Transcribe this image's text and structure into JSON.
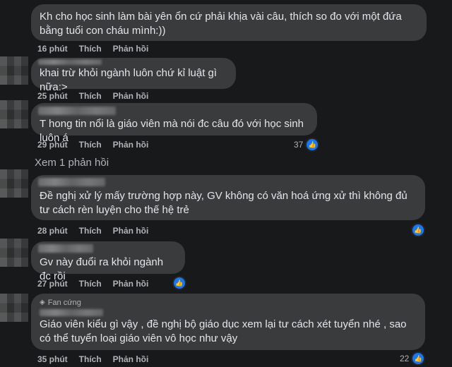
{
  "comments": [
    {
      "text": "Kh cho học sinh làm bài yên ổn cứ phải khịa vài câu, thích so đo với một đứa bằng tuổi con cháu mình:))",
      "time": "16 phút",
      "like": "Thích",
      "reply": "Phản hồi"
    },
    {
      "text": "khai trừ khỏi ngành luôn chứ kỉ luật gì nữa:>",
      "time": "25 phút",
      "like": "Thích",
      "reply": "Phản hồi"
    },
    {
      "text": "T hong tin nổi là giáo viên mà nói đc câu đó với học sinh luôn á",
      "time": "29 phút",
      "like": "Thích",
      "reply": "Phản hồi",
      "reactions": "37"
    },
    {
      "text": "Đề nghị xử lý mấy trường hợp này, GV không có văn hoá ứng xử thì không đủ tư cách rèn luyện cho thế hệ trẻ",
      "time": "28 phút",
      "like": "Thích",
      "reply": "Phản hồi"
    },
    {
      "text": "Gv này đuổi ra khỏi ngành đc rồi",
      "time": "27 phút",
      "like": "Thích",
      "reply": "Phản hồi"
    },
    {
      "badge": "Fan cứng",
      "text": "Giáo viên kiểu gì vậy , đề nghị bộ giáo dục xem lại tư cách xét tuyển nhé , sao có thể tuyển loại giáo viên vô học như vậy",
      "time": "35 phút",
      "like": "Thích",
      "reply": "Phản hồi",
      "reactions": "22"
    }
  ],
  "more_replies": "Xem 1 phản hồi",
  "colors": {
    "background": "#18191a",
    "bubble": "#3a3b3c",
    "text": "#e4e6eb",
    "meta": "#b0b3b8",
    "like_blue": "#1877f2"
  },
  "icons": {
    "reaction": "thumbs-up-icon",
    "badge": "diamond-icon"
  }
}
